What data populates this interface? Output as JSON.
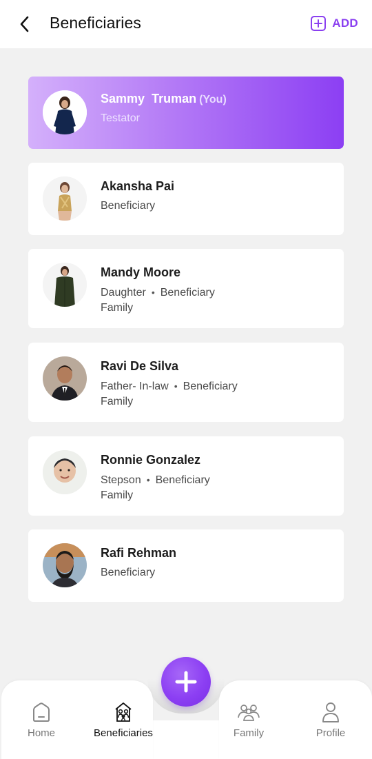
{
  "header": {
    "title": "Beneficiaries",
    "add_label": "ADD"
  },
  "people": [
    {
      "first": "Sammy",
      "last": "Truman",
      "you_tag": "(You)",
      "role": "Testator"
    },
    {
      "name": "Akansha Pai",
      "line1_a": "Beneficiary"
    },
    {
      "name": "Mandy Moore",
      "line1_a": "Daughter",
      "line1_b": "Beneficiary",
      "line2": "Family"
    },
    {
      "name": "Ravi De Silva",
      "line1_a": "Father- In-law",
      "line1_b": "Beneficiary",
      "line2": "Family"
    },
    {
      "name": "Ronnie Gonzalez",
      "line1_a": "Stepson",
      "line1_b": "Beneficiary",
      "line2": "Family"
    },
    {
      "name": "Rafi Rehman",
      "line1_a": "Beneficiary"
    }
  ],
  "nav": {
    "home": "Home",
    "beneficiaries": "Beneficiaries",
    "family": "Family",
    "profile": "Profile",
    "active": "beneficiaries"
  },
  "colors": {
    "accent": "#8a3ff0",
    "gradient_start": "#d4b0fb",
    "gradient_end": "#8c3ff3",
    "background": "#f1f1f1"
  },
  "icons": {
    "back": "chevron-left-icon",
    "add": "plus-square-icon",
    "fab": "plus-icon",
    "home": "home-icon",
    "beneficiaries": "family-house-icon",
    "family": "people-group-icon",
    "profile": "user-icon"
  }
}
